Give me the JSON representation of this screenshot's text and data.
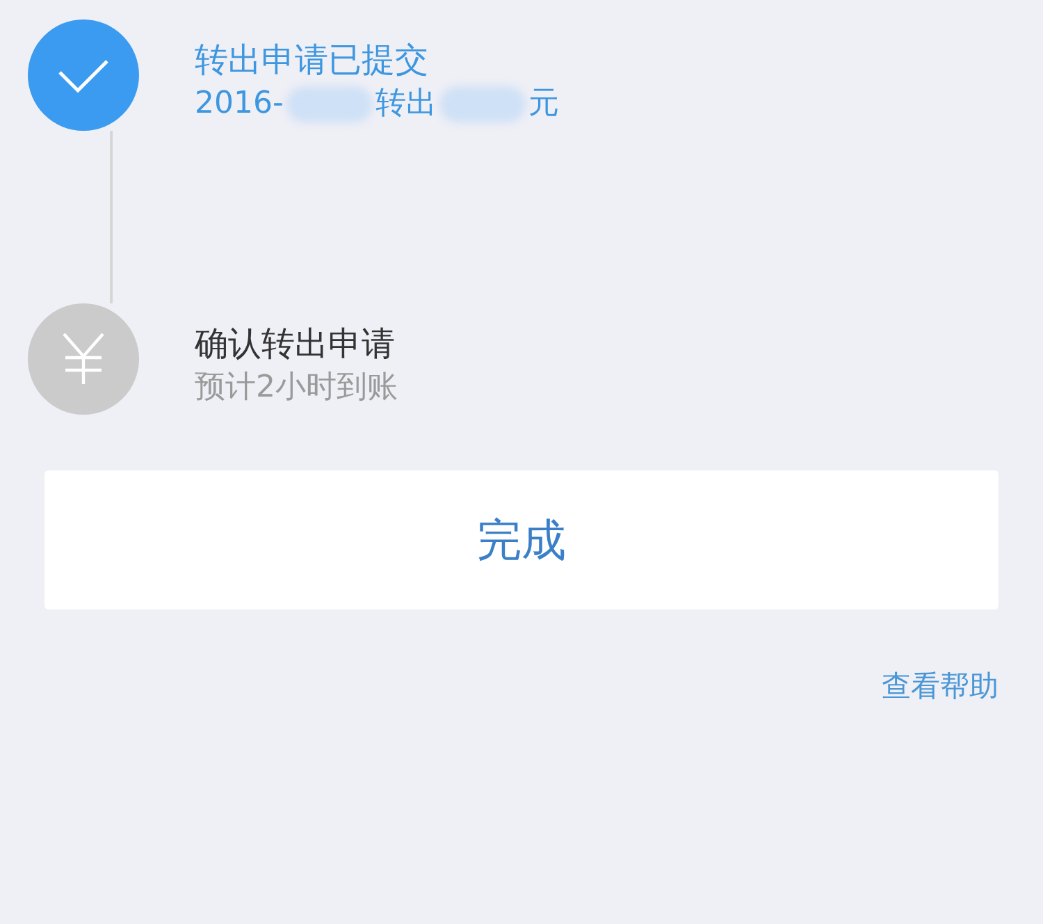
{
  "steps": [
    {
      "kind": "done",
      "done": true,
      "title": "转出申请已提交",
      "detail_segments": [
        "2016-",
        "转出",
        "元"
      ]
    },
    {
      "kind": "pending",
      "done": false,
      "title": "确认转出申请",
      "detail_segments": [
        "预计2小时到账"
      ]
    }
  ],
  "button": {
    "label": "完成"
  },
  "help_link": "查看帮助"
}
